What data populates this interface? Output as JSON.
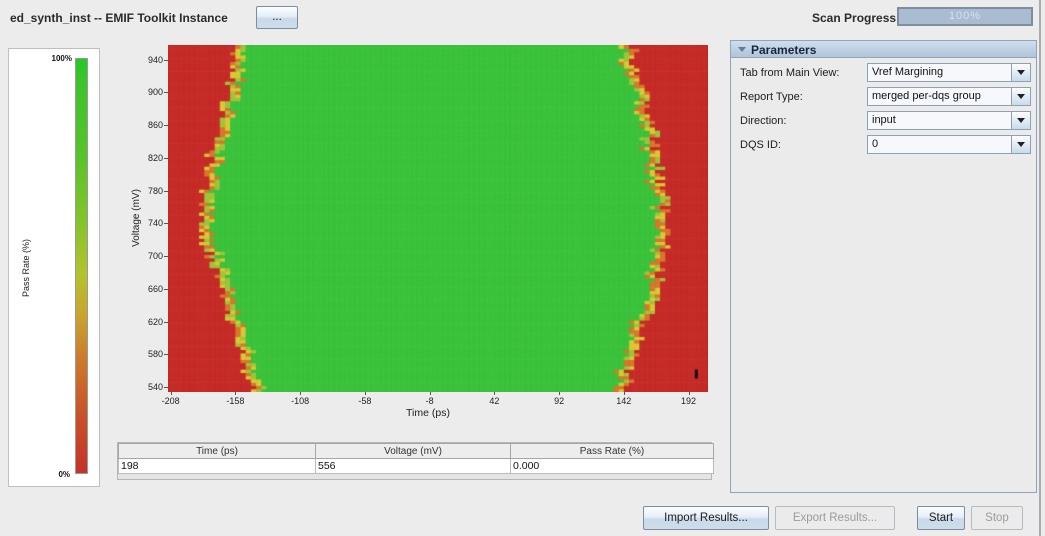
{
  "header": {
    "title": "ed_synth_inst -- EMIF Toolkit Instance",
    "more_button": "...",
    "scan_progress_label": "Scan Progress",
    "scan_progress_value": "100%",
    "scan_progress_percent": 100
  },
  "colorbar": {
    "top_label": "100%",
    "bottom_label": "0%",
    "axis_label": "Pass Rate (%)"
  },
  "parameters": {
    "title": "Parameters",
    "rows": [
      {
        "label": "Tab from Main View:",
        "value": "Vref Margining"
      },
      {
        "label": "Report Type:",
        "value": "merged per-dqs group"
      },
      {
        "label": "Direction:",
        "value": "input"
      },
      {
        "label": "DQS ID:",
        "value": "0"
      }
    ]
  },
  "readout_table": {
    "headers": [
      "Time (ps)",
      "Voltage (mV)",
      "Pass Rate (%)"
    ],
    "row": [
      "198",
      "556",
      "0.000"
    ]
  },
  "footer_buttons": [
    {
      "label": "Import Results...",
      "enabled": true
    },
    {
      "label": "Export Results...",
      "enabled": false
    },
    {
      "label": "Start",
      "enabled": true
    },
    {
      "label": "Stop",
      "enabled": false
    }
  ],
  "chart_data": {
    "type": "heatmap",
    "title": "Vref margin scan eye diagram",
    "xlabel": "Time (ps)",
    "ylabel": "Voltage (mV)",
    "x_ticks": [
      -208,
      -158,
      -108,
      -58,
      -8,
      42,
      92,
      142,
      192
    ],
    "y_ticks": [
      540,
      580,
      620,
      660,
      700,
      740,
      780,
      820,
      860,
      900,
      940
    ],
    "x_range": [
      -210,
      207
    ],
    "y_range": [
      534,
      958
    ],
    "cell_size_ps": 4,
    "cell_size_mv": 4,
    "legend_position": "left colorbar, 0% (red) to 100% (green)",
    "colors": {
      "pass": "#3bc33b",
      "fail": "#c62b27",
      "transition": [
        "#d8772b",
        "#d9c833",
        "#9fc43a"
      ]
    },
    "pass_region_boundary": [
      {
        "mv": 540,
        "left_ps": -143,
        "right_ps": 140
      },
      {
        "mv": 580,
        "left_ps": -149,
        "right_ps": 148
      },
      {
        "mv": 620,
        "left_ps": -156,
        "right_ps": 154
      },
      {
        "mv": 660,
        "left_ps": -164,
        "right_ps": 165
      },
      {
        "mv": 700,
        "left_ps": -174,
        "right_ps": 168
      },
      {
        "mv": 740,
        "left_ps": -182,
        "right_ps": 174
      },
      {
        "mv": 780,
        "left_ps": -178,
        "right_ps": 168
      },
      {
        "mv": 820,
        "left_ps": -174,
        "right_ps": 165
      },
      {
        "mv": 860,
        "left_ps": -165,
        "right_ps": 159
      },
      {
        "mv": 900,
        "left_ps": -160,
        "right_ps": 155
      },
      {
        "mv": 940,
        "left_ps": -154,
        "right_ps": 145
      }
    ],
    "selected_point": {
      "time_ps": 198,
      "voltage_mv": 556,
      "pass_rate": "0.000"
    }
  }
}
